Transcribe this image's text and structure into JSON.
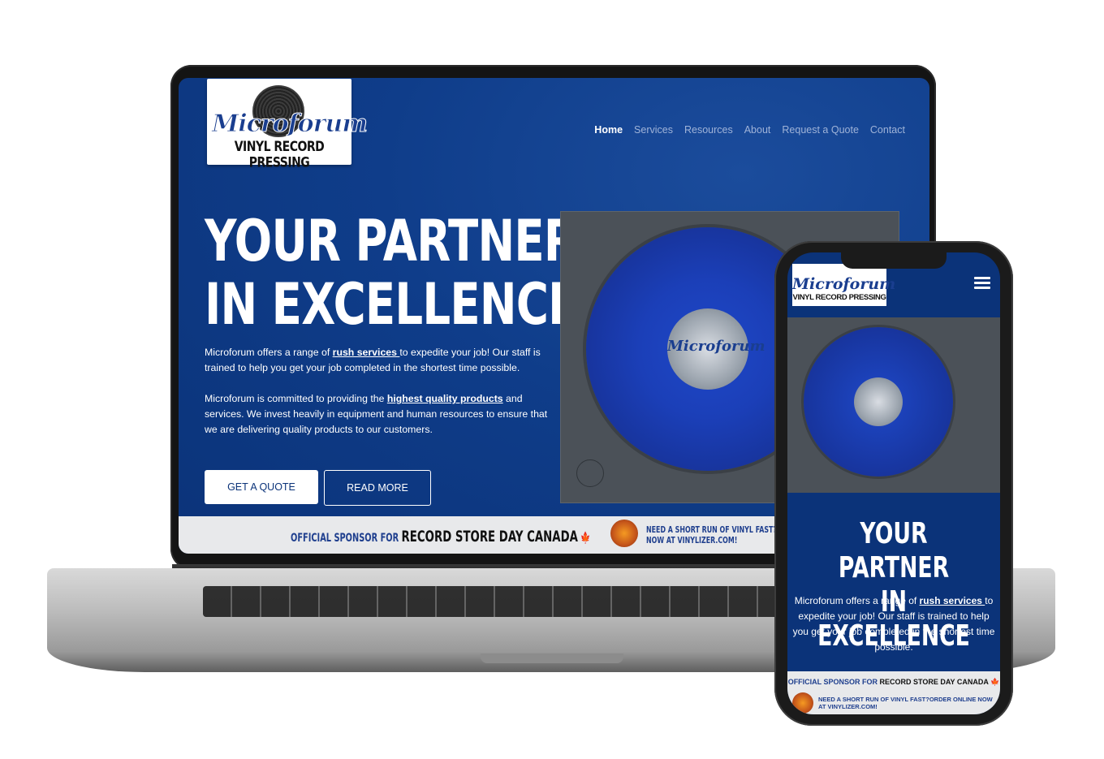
{
  "brand": {
    "logo_script": "Microforum",
    "logo_sub": "VINYL RECORD PRESSING"
  },
  "nav": {
    "items": [
      "Home",
      "Services",
      "Resources",
      "About",
      "Request a Quote",
      "Contact"
    ],
    "active": "Home"
  },
  "hero": {
    "title_line1": "YOUR PARTNER",
    "title_line2": "IN EXCELLENCE",
    "p1_before": "Microforum offers a range of ",
    "p1_link": "rush services ",
    "p1_after": "to expedite your job! Our staff is trained to help you get your job completed in the shortest time possible.",
    "p2_before": "Microforum is committed to providing the ",
    "p2_link": "highest quality products",
    "p2_after": " and services. We invest heavily in equipment and human resources to ensure that we are delivering quality products to our customers.",
    "btn_quote": "GET A QUOTE",
    "btn_more": "READ MORE"
  },
  "turntable": {
    "label_text": "Microforum",
    "label_ring": "VINYL RECORD PRESSING"
  },
  "sponsor": {
    "official": "OFFICIAL SPONSOR FOR ",
    "rsd": "RECORD STORE DAY CANADA",
    "maple": "🍁",
    "short_run_line1": "NEED A SHORT RUN OF VINYL FAST?ORD",
    "short_run_line2": "NOW AT VINYLIZER.COM!"
  },
  "mobile": {
    "p_before": "Microforum offers a range of ",
    "p_link": "rush services ",
    "p_after": "to expedite your job! Our staff is trained to help you get your job completed in the shortest time possible.",
    "short_run": "NEED A SHORT RUN OF VINYL FAST?ORDER ONLINE NOW AT VINYLIZER.COM!"
  },
  "colors": {
    "brand_blue": "#0b3379",
    "accent_blue": "#1f3f8e",
    "vinyl_blue": "#1b3fb8",
    "sponsor_bg": "#e8e9eb"
  },
  "icons": {
    "menu": "hamburger-menu-icon",
    "vinyl": "vinyl-record-icon",
    "maple": "maple-leaf-icon"
  }
}
